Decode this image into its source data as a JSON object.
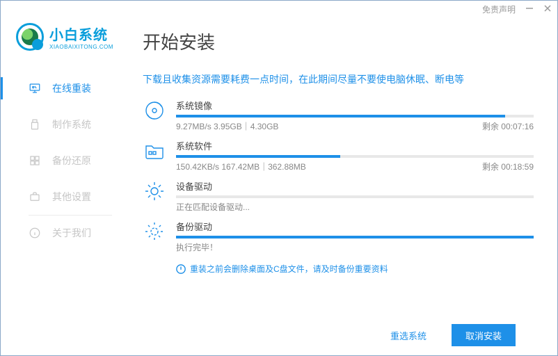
{
  "titlebar": {
    "disclaimer": "免责声明"
  },
  "logo": {
    "cn": "小白系统",
    "en": "XIAOBAIXITONG.COM"
  },
  "sidebar": {
    "items": [
      {
        "label": "在线重装"
      },
      {
        "label": "制作系统"
      },
      {
        "label": "备份还原"
      },
      {
        "label": "其他设置"
      },
      {
        "label": "关于我们"
      }
    ]
  },
  "main": {
    "title": "开始安装",
    "notice": "下载且收集资源需要耗费一点时间，在此期间尽量不要使电脑休眠、断电等",
    "tasks": [
      {
        "name": "系统镜像",
        "progress_pct": 92,
        "detail": "9.27MB/s 3.95GB｜4.30GB",
        "remaining": "剩余 00:07:16"
      },
      {
        "name": "系统软件",
        "progress_pct": 46,
        "detail": "150.42KB/s 167.42MB｜362.88MB",
        "remaining": "剩余 00:18:59"
      },
      {
        "name": "设备驱动",
        "progress_pct": 0,
        "detail": "正在匹配设备驱动...",
        "remaining": ""
      },
      {
        "name": "备份驱动",
        "progress_pct": 100,
        "detail": "执行完毕！",
        "remaining": ""
      }
    ],
    "warning": "重装之前会删除桌面及C盘文件，请及时备份重要资料"
  },
  "footer": {
    "reselect": "重选系统",
    "cancel": "取消安装"
  }
}
